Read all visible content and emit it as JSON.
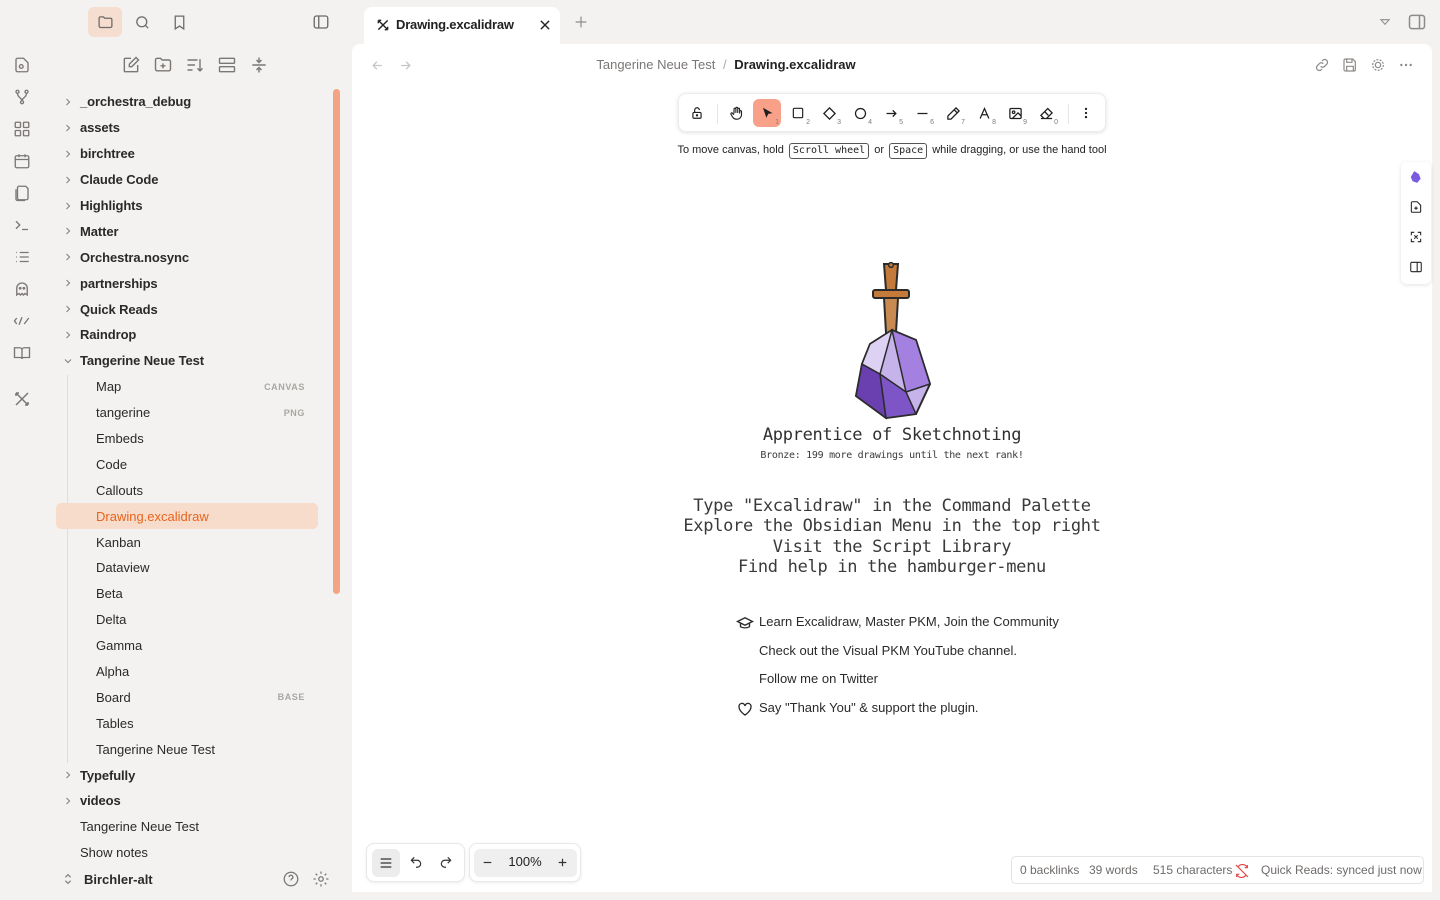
{
  "tabs": [
    {
      "title": "Drawing.excalidraw",
      "icon": "excalidraw-icon"
    }
  ],
  "breadcrumb": {
    "parent": "Tangerine Neue Test",
    "separator": "/",
    "current": "Drawing.excalidraw"
  },
  "tree": {
    "items": [
      {
        "label": "_orchestra_debug",
        "kind": "folder",
        "expanded": false
      },
      {
        "label": "assets",
        "kind": "folder",
        "expanded": false
      },
      {
        "label": "birchtree",
        "kind": "folder",
        "expanded": false
      },
      {
        "label": "Claude Code",
        "kind": "folder",
        "expanded": false
      },
      {
        "label": "Highlights",
        "kind": "folder",
        "expanded": false
      },
      {
        "label": "Matter",
        "kind": "folder",
        "expanded": false
      },
      {
        "label": "Orchestra.nosync",
        "kind": "folder",
        "expanded": false
      },
      {
        "label": "partnerships",
        "kind": "folder",
        "expanded": false
      },
      {
        "label": "Quick Reads",
        "kind": "folder",
        "expanded": false
      },
      {
        "label": "Raindrop",
        "kind": "folder",
        "expanded": false
      },
      {
        "label": "Tangerine Neue Test",
        "kind": "folder",
        "expanded": true
      },
      {
        "label": "Map",
        "kind": "file",
        "tag": "CANVAS"
      },
      {
        "label": "tangerine",
        "kind": "file",
        "tag": "PNG"
      },
      {
        "label": "Embeds",
        "kind": "file"
      },
      {
        "label": "Code",
        "kind": "file"
      },
      {
        "label": "Callouts",
        "kind": "file"
      },
      {
        "label": "Drawing.excalidraw",
        "kind": "file",
        "active": true
      },
      {
        "label": "Kanban",
        "kind": "file"
      },
      {
        "label": "Dataview",
        "kind": "file"
      },
      {
        "label": "Beta",
        "kind": "file"
      },
      {
        "label": "Delta",
        "kind": "file"
      },
      {
        "label": "Gamma",
        "kind": "file"
      },
      {
        "label": "Alpha",
        "kind": "file"
      },
      {
        "label": "Board",
        "kind": "file",
        "tag": "BASE"
      },
      {
        "label": "Tables",
        "kind": "file"
      },
      {
        "label": "Tangerine Neue Test",
        "kind": "file"
      },
      {
        "label": "Typefully",
        "kind": "folder",
        "expanded": false
      },
      {
        "label": "videos",
        "kind": "folder",
        "expanded": false
      },
      {
        "label": "Tangerine Neue Test",
        "kind": "top-file"
      },
      {
        "label": "Show notes",
        "kind": "top-file"
      }
    ]
  },
  "vault": {
    "name": "Birchler-alt"
  },
  "hint": {
    "pre": "To move canvas, hold",
    "key1": "Scroll wheel",
    "or": "or",
    "key2": "Space",
    "post": "while dragging, or use the hand tool"
  },
  "welcome": {
    "rank_title": "Apprentice of Sketchnoting",
    "rank_sub": "Bronze: 199 more drawings until the next rank!",
    "lines": [
      "Type \"Excalidraw\" in the Command Palette",
      "Explore the Obsidian Menu in the top right",
      "Visit the Script Library",
      "Find help in the hamburger-menu"
    ],
    "links": [
      "Learn Excalidraw, Master PKM, Join the Community",
      "Check out the Visual PKM YouTube channel.",
      "Follow me on Twitter",
      "Say \"Thank You\" & support the plugin."
    ]
  },
  "tool_numbers": [
    "1",
    "2",
    "3",
    "4",
    "5",
    "6",
    "7",
    "8",
    "9",
    "0"
  ],
  "zoom": "100%",
  "status": {
    "backlinks": "0 backlinks",
    "words": "39 words",
    "chars": "515 characters",
    "sync": "Quick Reads: synced just now"
  },
  "colors": {
    "accent": "#e8641c",
    "active_bg": "#f7dccb",
    "tool_active": "#f9a088"
  }
}
